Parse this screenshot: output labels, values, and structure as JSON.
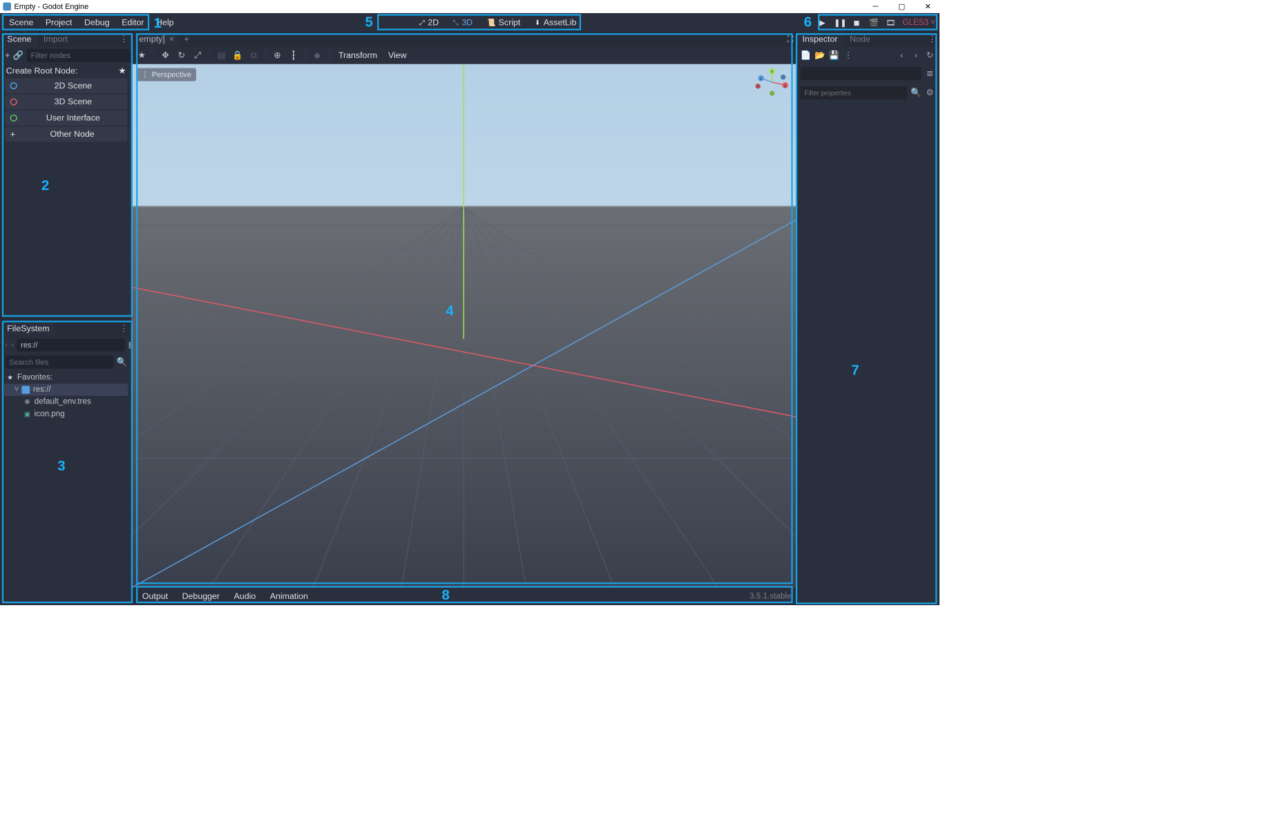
{
  "title": "Empty - Godot Engine",
  "menu": {
    "scene": "Scene",
    "project": "Project",
    "debug": "Debug",
    "editor": "Editor",
    "help": "Help"
  },
  "workspace": {
    "d2": "2D",
    "d3": "3D",
    "script": "Script",
    "assetlib": "AssetLib"
  },
  "renderer": "GLES3",
  "scenePanel": {
    "tabScene": "Scene",
    "tabImport": "Import",
    "filterPlaceholder": "Filter nodes",
    "createRoot": "Create Root Node:",
    "btn2d": "2D Scene",
    "btn3d": "3D Scene",
    "btnUi": "User Interface",
    "btnOther": "Other Node"
  },
  "filesystem": {
    "title": "FileSystem",
    "path": "res://",
    "searchPlaceholder": "Search files",
    "fav": "Favorites:",
    "root": "res://",
    "file1": "default_env.tres",
    "file2": "icon.png"
  },
  "centerTab": "empty]",
  "perspective": "Perspective",
  "toolbar": {
    "transform": "Transform",
    "view": "View"
  },
  "bottom": {
    "output": "Output",
    "debugger": "Debugger",
    "audio": "Audio",
    "animation": "Animation"
  },
  "version": "3.5.1.stable",
  "inspector": {
    "tab1": "Inspector",
    "tab2": "Node",
    "filterPlaceholder": "Filter properties"
  },
  "annotations": {
    "n1": "1",
    "n2": "2",
    "n3": "3",
    "n4": "4",
    "n5": "5",
    "n6": "6",
    "n7": "7",
    "n8": "8"
  }
}
